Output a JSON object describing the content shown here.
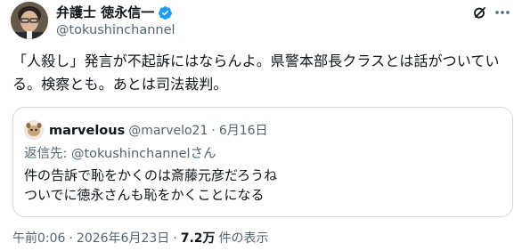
{
  "author": {
    "display_name": "弁護士 徳永信一",
    "handle": "@tokushinchannel",
    "verified": true
  },
  "tweet": {
    "line1": "「人殺し」発言が不起訴にはならんよ。県警本部長クラスとは話がついてい",
    "line2": "る。検察とも。あとは司法裁判。"
  },
  "quote": {
    "display_name": "marvelous",
    "handle": "@marvelo21",
    "separator": "·",
    "date": "6月16日",
    "reply_prefix": "返信先: ",
    "reply_mention": "@tokushinchannel",
    "reply_suffix": "さん",
    "line1": "件の告訴で恥をかくのは斎藤元彦だろうね",
    "line2": "ついでに徳永さんも恥をかくことになる"
  },
  "meta": {
    "time": "午前0:06",
    "sep1": "·",
    "date": "2026年6月23日",
    "sep2": "·",
    "views_count": "7.2万",
    "views_label": "件の表示"
  },
  "icons": {
    "verified": "verified-badge-icon",
    "grok": "grok-icon",
    "more": "more-options-icon"
  },
  "colors": {
    "accent": "#1d9bf0",
    "text": "#0f1419",
    "secondary": "#536471",
    "border": "#cfd9de"
  }
}
